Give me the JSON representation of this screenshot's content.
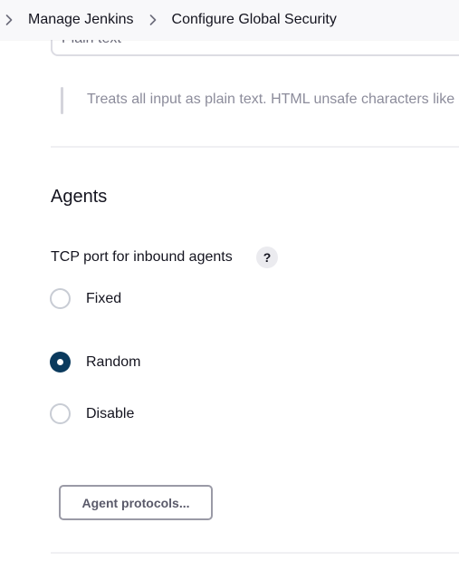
{
  "breadcrumb": {
    "items": [
      {
        "label": "Manage Jenkins"
      },
      {
        "label": "Configure Global Security"
      }
    ]
  },
  "markup_formatter": {
    "value": "Plain text",
    "help": "Treats all input as plain text. HTML unsafe characters like"
  },
  "agents": {
    "title": "Agents",
    "tcp_port_label": "TCP port for inbound agents",
    "help_button": "?",
    "options": [
      {
        "label": "Fixed",
        "checked": false
      },
      {
        "label": "Random",
        "checked": true
      },
      {
        "label": "Disable",
        "checked": false
      }
    ],
    "protocols_button": "Agent protocols..."
  },
  "colors": {
    "radio_checked": "#0b3a5d",
    "breadcrumb_bg": "#f8f8fa"
  }
}
